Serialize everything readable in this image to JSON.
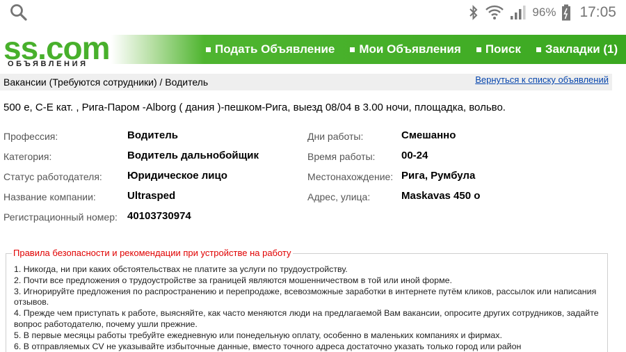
{
  "status_bar": {
    "battery_percent": "96%",
    "time": "17:05",
    "icons": [
      "search-icon",
      "bluetooth-icon",
      "wifi-icon",
      "signal-icon",
      "battery-icon"
    ]
  },
  "header": {
    "logo_text": "ss.com",
    "logo_subtext": "ОБЪЯВЛЕНИЯ",
    "nav": [
      {
        "label": "Подать Объявление"
      },
      {
        "label": "Мои Объявления"
      },
      {
        "label": "Поиск"
      },
      {
        "label": "Закладки (1)"
      }
    ],
    "colors": {
      "brand_green": "#48b02c",
      "nav_bg": "#3aa820"
    }
  },
  "breadcrumb": {
    "path": "Вакансии (Требуются сотрудники) / Водитель",
    "back_link": "Вернуться к списку объявлений"
  },
  "description": "500 е, С-Е кат. , Рига-Паром -Alborg ( дания )-пешком-Рига, выезд 08/04 в 3.00 ночи, площадка, вольво.",
  "details_left": [
    {
      "label": "Профессия:",
      "value": "Водитель"
    },
    {
      "label": "Категория:",
      "value": "Водитель дальнобойщик"
    },
    {
      "label": "Статус работодателя:",
      "value": "Юридическое лицо"
    },
    {
      "label": "Название компании:",
      "value": "Ultrasped"
    },
    {
      "label": "Регистрационный номер:",
      "value": "40103730974"
    }
  ],
  "details_right": [
    {
      "label": "Дни работы:",
      "value": "Смешанно"
    },
    {
      "label": "Время работы:",
      "value": "00-24"
    },
    {
      "label": "Местонахождение:",
      "value": "Рига, Румбула"
    },
    {
      "label": "Адрес, улица:",
      "value": "Maskavas 450 o"
    }
  ],
  "rules": {
    "title": "Правила безопасности и рекомендации при устройстве на работу",
    "items": [
      "1. Никогда, ни при каких обстоятельствах не платите за услуги по трудоустройству.",
      "2. Почти все предложения о трудоустройстве за границей являются мошенничеством в той или иной форме.",
      "3. Игнорируйте предложения по распространению и перепродаже, всевозможные заработки в интернете путём кликов, рассылок или написания отзывов.",
      "4. Прежде чем приступать к работе, выясняйте, как часто меняются люди на предлагаемой Вам вакансии, опросите других сотрудников, задайте вопрос работодателю, почему ушли прежние.",
      "5. В первые месяцы работы требуйте ежедневную или понедельную оплату, особенно в маленьких компаниях и фирмах.",
      "6. В отправляемых CV не указывайте избыточные данные, вместо точного адреса достаточно указать только город или район"
    ]
  }
}
